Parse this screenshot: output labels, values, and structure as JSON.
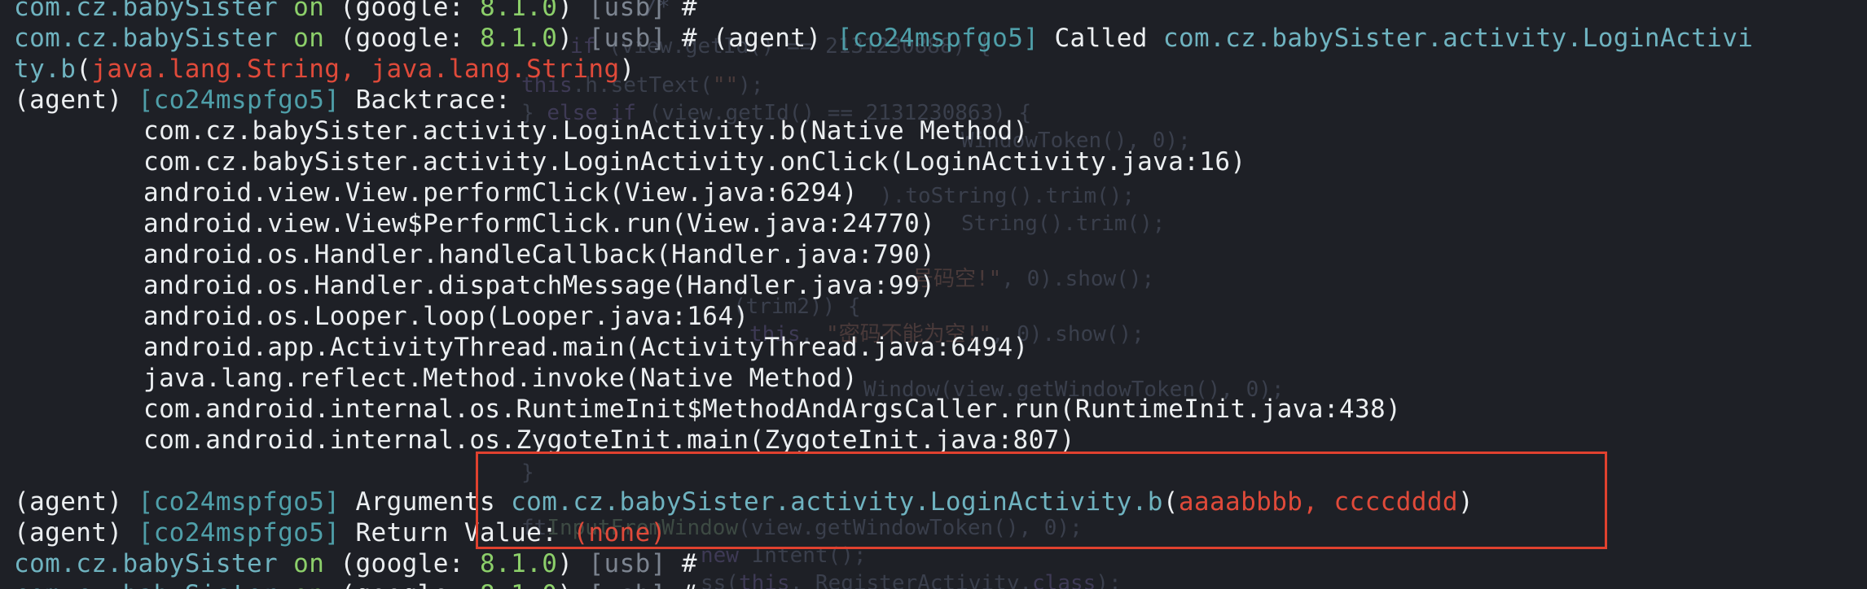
{
  "prompt": {
    "package": "com.cz.babySister",
    "on_word": "on",
    "device_open": "(google: ",
    "version": "8.1.0",
    "device_close": ")",
    "usb": "[usb]",
    "hash": "#"
  },
  "agent": {
    "label": "(agent)",
    "job_id": "[co24mspfgo5]"
  },
  "called_line": {
    "command": "(agent)",
    "job_id": "[co24mspfgo5]",
    "called_word": "Called",
    "method_part1": "com.cz.babySister.activity.LoginActivi",
    "method_part2": "ty.b",
    "args_open": "(",
    "args": "java.lang.String, java.lang.String",
    "args_close": ")"
  },
  "backtrace": {
    "title": "Backtrace:",
    "frames": [
      "com.cz.babySister.activity.LoginActivity.b(Native Method)",
      "com.cz.babySister.activity.LoginActivity.onClick(LoginActivity.java:16)",
      "android.view.View.performClick(View.java:6294)",
      "android.view.View$PerformClick.run(View.java:24770)",
      "android.os.Handler.handleCallback(Handler.java:790)",
      "android.os.Handler.dispatchMessage(Handler.java:99)",
      "android.os.Looper.loop(Looper.java:164)",
      "android.app.ActivityThread.main(ActivityThread.java:6494)",
      "java.lang.reflect.Method.invoke(Native Method)",
      "com.android.internal.os.RuntimeInit$MethodAndArgsCaller.run(RuntimeInit.java:438)",
      "com.android.internal.os.ZygoteInit.main(ZygoteInit.java:807)"
    ]
  },
  "arguments_line": {
    "label": "Arguments",
    "method": "com.cz.babySister.activity.LoginActivity.b",
    "open": "(",
    "values": "aaaabbbb, ccccdddd",
    "close": ")"
  },
  "return_line": {
    "label": "Return Value:",
    "value": "(none)"
  },
  "colors": {
    "background": "#1e2026",
    "package": "#6fb3c0",
    "green": "#8ccf6a",
    "job_id": "#4f9fa9",
    "args_red": "#e04a3a",
    "highlight_border": "#e0412f",
    "text": "#eceff1"
  }
}
